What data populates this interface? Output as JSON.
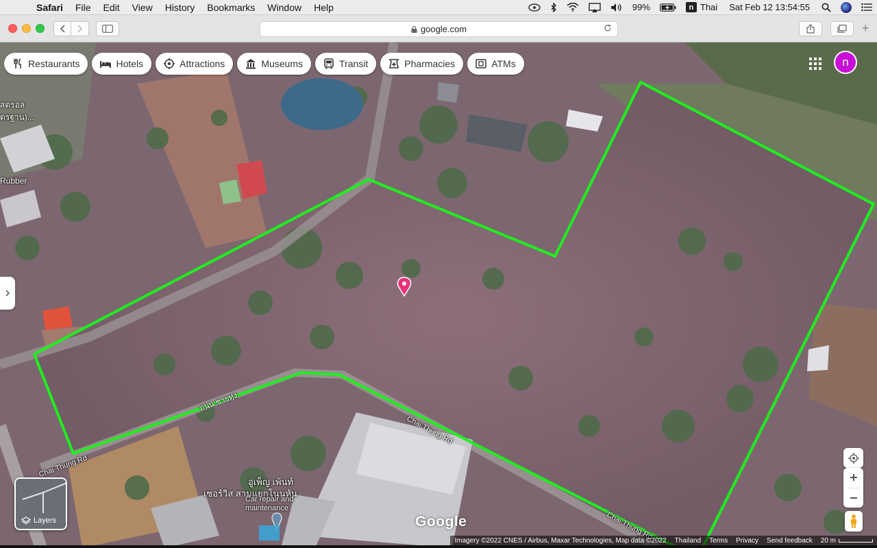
{
  "menubar": {
    "app": "Safari",
    "items": [
      "File",
      "Edit",
      "View",
      "History",
      "Bookmarks",
      "Window",
      "Help"
    ],
    "battery": "99%",
    "input_source": "Thai",
    "input_source_letter": "n",
    "datetime": "Sat Feb 12  13:54:55"
  },
  "browser": {
    "url": "google.com"
  },
  "map": {
    "categories": [
      {
        "label": "Restaurants",
        "icon": "fork-knife-icon"
      },
      {
        "label": "Hotels",
        "icon": "bed-icon"
      },
      {
        "label": "Attractions",
        "icon": "attraction-icon"
      },
      {
        "label": "Museums",
        "icon": "museum-icon"
      },
      {
        "label": "Transit",
        "icon": "bus-icon"
      },
      {
        "label": "Pharmacies",
        "icon": "pharmacy-icon"
      },
      {
        "label": "ATMs",
        "icon": "atm-icon"
      }
    ],
    "account_initial": "n",
    "labels": {
      "thai_top_1": "สตรอล",
      "thai_top_2": "ตรฐาน)...",
      "rubber": "Rubber",
      "road_thai": "ถนน ชายทุ่ง",
      "road_1": "Chai Thung Rd",
      "road_2": "Chai Thung Rd",
      "road_3": "Chai Thung Rd",
      "poi_name_1": "อู่เพ็ญ เพ้นท์",
      "poi_name_2": "เซอร์วิส สามแยกโนนหัน",
      "poi_type_1": "Car repair and",
      "poi_type_2": "maintenance"
    },
    "layers_label": "Layers",
    "google_logo": "Google",
    "footer": {
      "imagery": "Imagery ©2022 CNES / Airbus, Maxar Technologies, Map data ©2022",
      "country": "Thailand",
      "terms": "Terms",
      "privacy": "Privacy",
      "feedback": "Send feedback",
      "scale": "20 m"
    }
  }
}
